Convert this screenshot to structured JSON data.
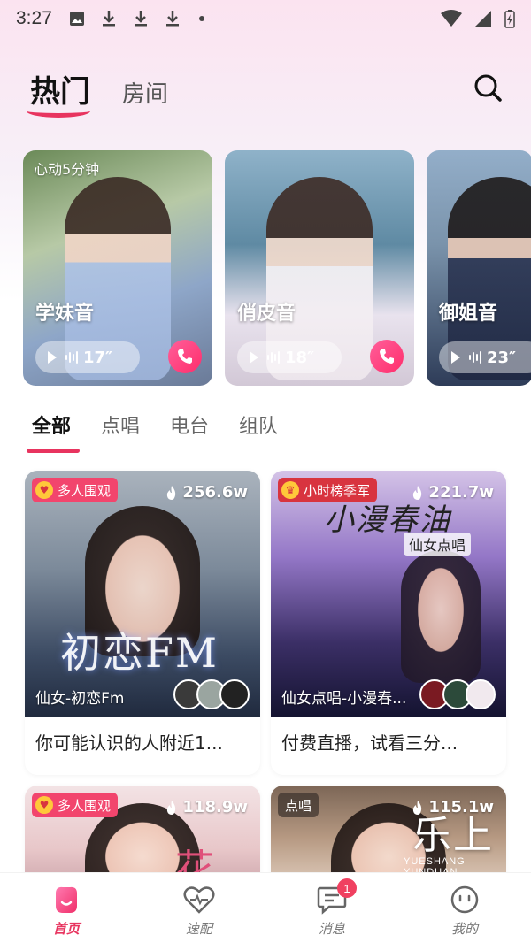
{
  "status_bar": {
    "time": "3:27"
  },
  "header": {
    "tabs": [
      {
        "label": "热门",
        "active": true
      },
      {
        "label": "房间",
        "active": false
      }
    ]
  },
  "voice_cards": [
    {
      "tag": "心动5分钟",
      "name": "学妹音",
      "duration": "17″"
    },
    {
      "tag": "",
      "name": "俏皮音",
      "duration": "18″"
    },
    {
      "tag": "",
      "name": "御姐音",
      "duration": "23″"
    }
  ],
  "category_tabs": [
    {
      "label": "全部",
      "active": true
    },
    {
      "label": "点唱",
      "active": false
    },
    {
      "label": "电台",
      "active": false
    },
    {
      "label": "组队",
      "active": false
    }
  ],
  "rooms": [
    {
      "badge": "多人围观",
      "heat": "256.6w",
      "host": "仙女-初恋Fm",
      "desc": "你可能认识的人附近1...",
      "cover_text": "初恋FM"
    },
    {
      "badge": "小时榜季军",
      "heat": "221.7w",
      "host": "仙女点唱-小漫春...",
      "desc": "付费直播，试看三分...",
      "cover_text": "小漫春油",
      "cover_sub": "仙女点唱"
    },
    {
      "badge": "多人围观",
      "heat": "118.9w",
      "cover_text": "花"
    },
    {
      "badge": "点唱",
      "heat": "115.1w",
      "cover_text": "乐上",
      "cover_en": "YUESHANG YUNDUAN"
    }
  ],
  "bottom_nav": [
    {
      "label": "首页",
      "active": true
    },
    {
      "label": "速配",
      "active": false
    },
    {
      "label": "消息",
      "active": false,
      "badge": "1"
    },
    {
      "label": "我的",
      "active": false
    }
  ],
  "colors": {
    "accent": "#e8345f",
    "call_button": "#ff2d6b"
  }
}
